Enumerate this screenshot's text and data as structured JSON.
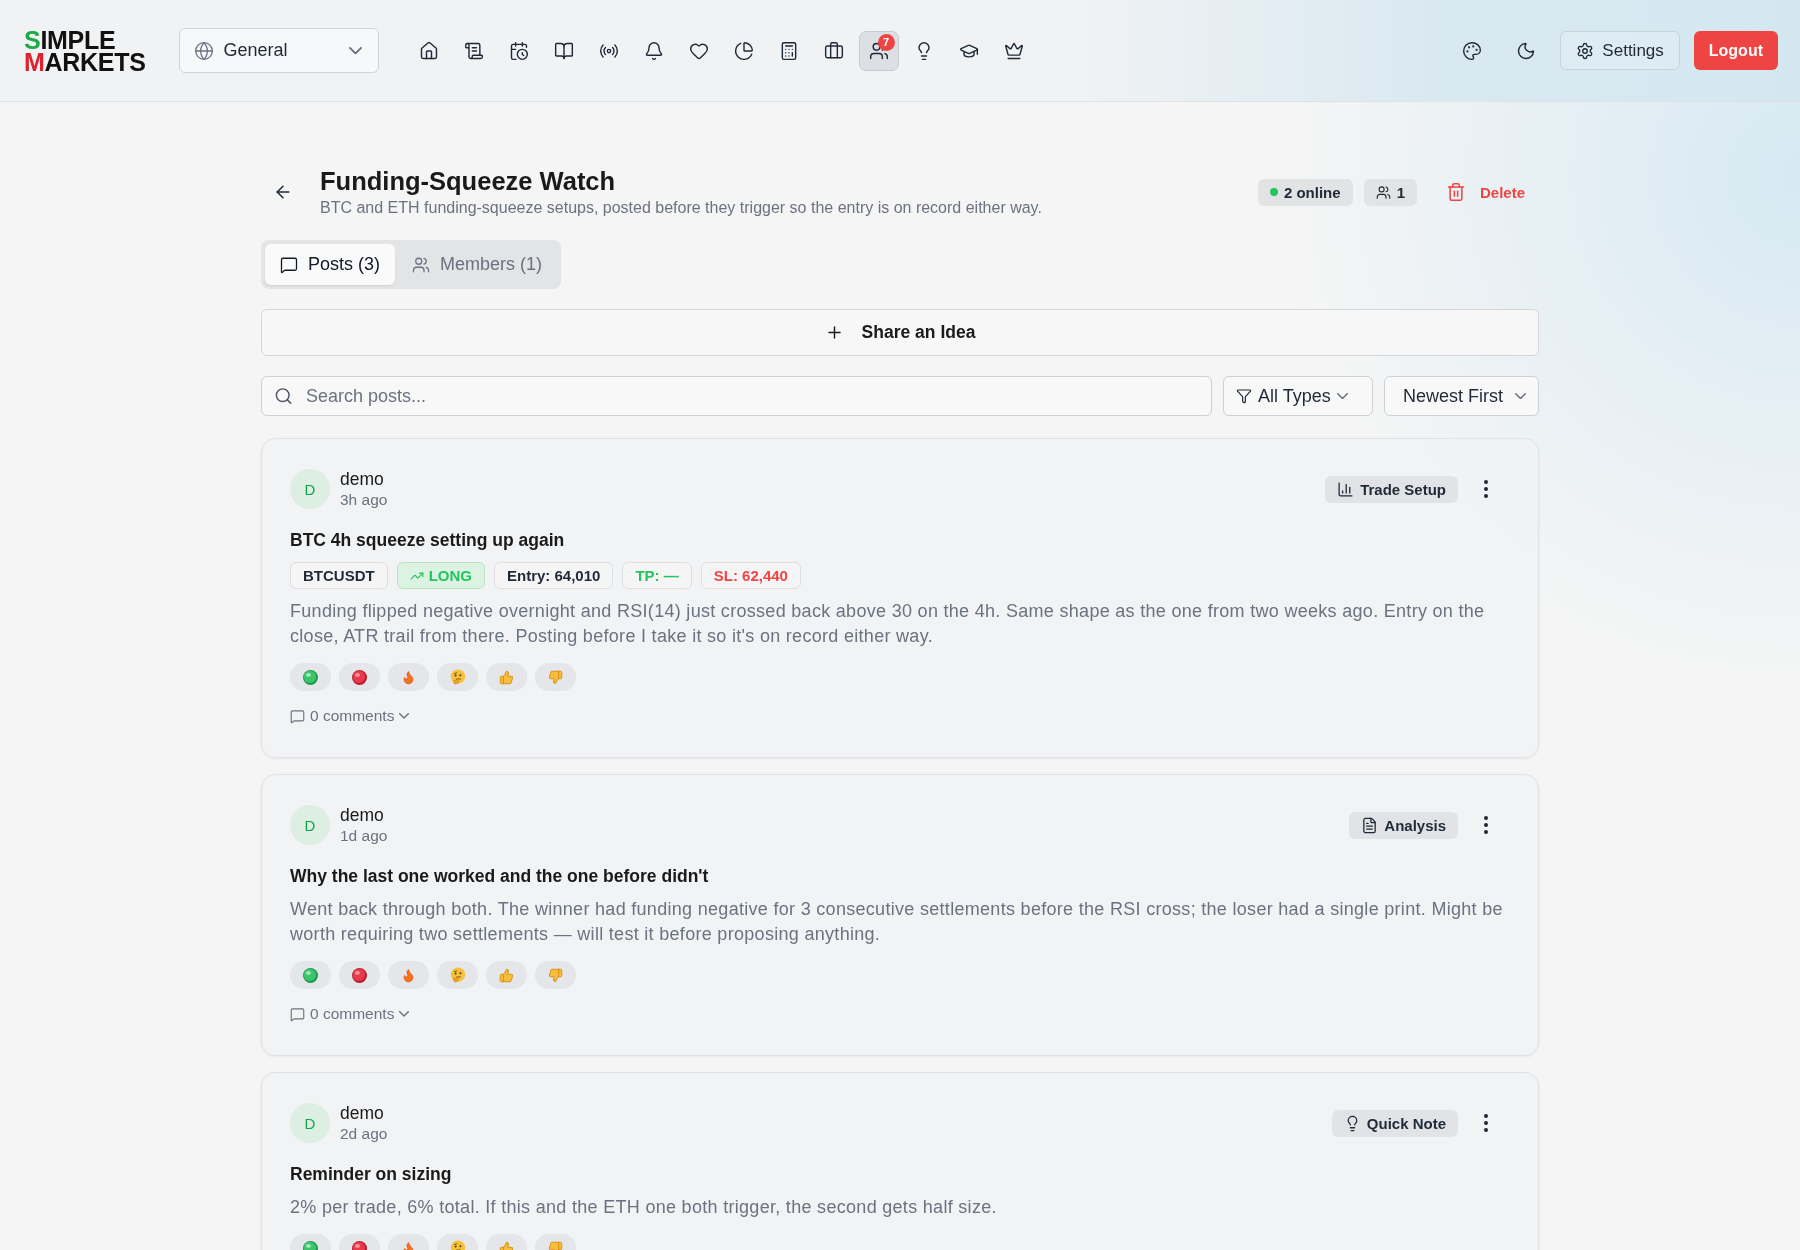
{
  "topbar": {
    "logo": {
      "line1": "SIMPLE",
      "line2": "MARKETS"
    },
    "workspace": "General",
    "nav": [
      {
        "kind": "home",
        "selected": false
      },
      {
        "kind": "scroll",
        "selected": false
      },
      {
        "kind": "calendar",
        "selected": false
      },
      {
        "kind": "book",
        "selected": false
      },
      {
        "kind": "broadcast",
        "selected": false
      },
      {
        "kind": "bell",
        "selected": false
      },
      {
        "kind": "heart",
        "selected": false
      },
      {
        "kind": "pie",
        "selected": false
      },
      {
        "kind": "calculator",
        "selected": false
      },
      {
        "kind": "briefcase",
        "selected": false
      },
      {
        "kind": "users",
        "selected": true,
        "badge": "7"
      },
      {
        "kind": "lightbulb",
        "selected": false
      },
      {
        "kind": "cap",
        "selected": false
      },
      {
        "kind": "crown",
        "selected": false
      }
    ],
    "settings": "Settings",
    "logout": "Logout"
  },
  "group": {
    "title": "Funding-Squeeze Watch",
    "description": "BTC and ETH funding-squeeze setups, posted before they trigger so the entry is on record either way.",
    "online": "2 online",
    "members": "1",
    "delete": "Delete"
  },
  "tabs": [
    {
      "kind": "posts",
      "label": "Posts (3)",
      "selected": true
    },
    {
      "kind": "members",
      "label": "Members (1)",
      "selected": false
    }
  ],
  "share_button": "Share an Idea",
  "search": {
    "placeholder": "Search posts..."
  },
  "type_filter": "All Types",
  "sort": "Newest First",
  "posts": [
    {
      "author": "demo",
      "initial": "D",
      "time": "3h ago",
      "type": {
        "kind": "trade",
        "label": "Trade Setup"
      },
      "title": "BTC 4h squeeze setting up again",
      "chips": [
        {
          "kind": "plain",
          "text": "BTCUSDT"
        },
        {
          "kind": "long",
          "text": "LONG"
        },
        {
          "kind": "plain",
          "text": "Entry: 64,010"
        },
        {
          "kind": "profit",
          "text": "TP: —"
        },
        {
          "kind": "loss",
          "text": "SL: 62,440"
        }
      ],
      "body": "Funding flipped negative overnight and RSI(14) just crossed back above 30 on the 4h. Same shape as the one from two weeks ago. Entry on the close, ATR trail from there. Posting before I take it so it's on record either way.",
      "reactions": [
        {
          "kind": "greenball"
        },
        {
          "kind": "redball"
        },
        {
          "kind": "fire"
        },
        {
          "kind": "thinking"
        },
        {
          "kind": "thumbsup"
        },
        {
          "kind": "thumbsdown"
        }
      ],
      "comments": {
        "label": "0 comments",
        "expanded": false
      }
    },
    {
      "author": "demo",
      "initial": "D",
      "time": "1d ago",
      "type": {
        "kind": "analysis",
        "label": "Analysis"
      },
      "title": "Why the last one worked and the one before didn't",
      "body": "Went back through both. The winner had funding negative for 3 consecutive settlements before the RSI cross; the loser had a single print. Might be worth requiring two settlements — will test it before proposing anything.",
      "reactions": [
        {
          "kind": "greenball"
        },
        {
          "kind": "redball"
        },
        {
          "kind": "fire"
        },
        {
          "kind": "thinking"
        },
        {
          "kind": "thumbsup"
        },
        {
          "kind": "thumbsdown"
        }
      ],
      "comments": {
        "label": "0 comments",
        "expanded": false
      }
    },
    {
      "author": "demo",
      "initial": "D",
      "time": "2d ago",
      "type": {
        "kind": "note",
        "label": "Quick Note"
      },
      "title": "Reminder on sizing",
      "body": "2% per trade, 6% total. If this and the ETH one both trigger, the second gets half size.",
      "reactions": [
        {
          "kind": "greenball"
        },
        {
          "kind": "redball"
        },
        {
          "kind": "fire"
        },
        {
          "kind": "thinking"
        },
        {
          "kind": "thumbsup"
        },
        {
          "kind": "thumbsdown"
        }
      ]
    }
  ]
}
